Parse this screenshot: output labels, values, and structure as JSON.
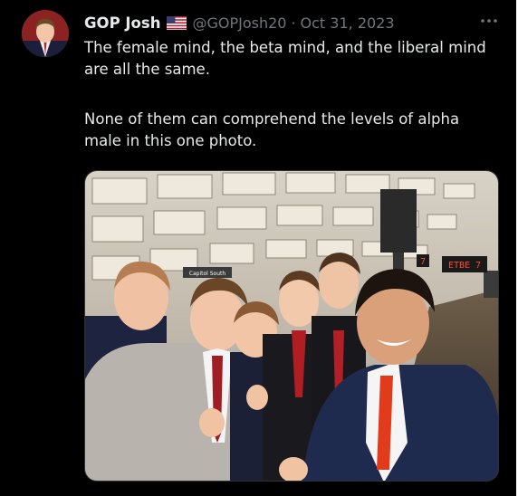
{
  "tweet": {
    "display_name": "GOP Josh",
    "handle": "@GOPJosh20",
    "separator": "·",
    "date": "Oct 31, 2023",
    "text_paragraph_1": "The female mind, the beta mind, and the liberal mind are all the same.",
    "text_paragraph_2": "None of them can comprehend the levels of alpha male in this one photo.",
    "more_icon": "more-horizontal-icon",
    "flag_icon": "us-flag-icon",
    "photo_signs": {
      "left_sign": "Capitol South",
      "board_number": "7",
      "board_text": "ETBE 7"
    }
  },
  "colors": {
    "background": "#000000",
    "primary_text": "#e7e9ea",
    "secondary_text": "#71767b"
  }
}
